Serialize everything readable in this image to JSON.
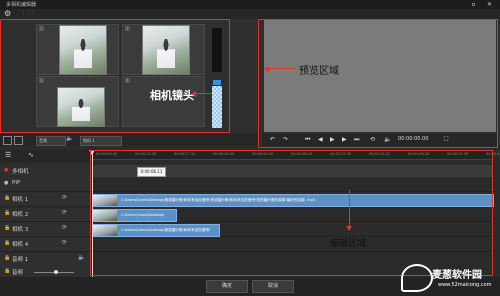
{
  "window": {
    "title": "多相机编辑器",
    "minimize": "▫",
    "close": "✕"
  },
  "toolbar": {
    "settings_icon": "gear-icon",
    "grip": "⋮⋮⋮"
  },
  "camera_grid": {
    "cells": [
      {
        "num": "1",
        "has_photo": true
      },
      {
        "num": "2",
        "has_photo": true
      },
      {
        "num": "3",
        "has_photo": true
      },
      {
        "num": "4",
        "has_photo": false
      }
    ]
  },
  "camera_toolbar": {
    "audio_label": "音频",
    "camera_label": "相机 1"
  },
  "preview_controls": {
    "timecode": "00:00:00.00"
  },
  "timeline": {
    "ruler_ticks": [
      "00:00:00.00",
      "00:00:13.20",
      "00:00:27.10",
      "00:00:40.30",
      "00:00:54.20",
      "00:01:08.10",
      "00:01:21.30",
      "00:01:35.20",
      "00:01:49.10",
      "00:02:02.30",
      "00:02:16.20"
    ],
    "tooltip": "0:00:06.11",
    "tracks": [
      {
        "label": "多相机"
      },
      {
        "label": "PIP"
      },
      {
        "label": "相机 1"
      },
      {
        "label": "相机 2"
      },
      {
        "label": "相机 3"
      },
      {
        "label": "相机 4"
      },
      {
        "label": "音频 1"
      },
      {
        "label": "音频"
      }
    ],
    "clips": [
      {
        "path": "C:\\Users\\Users\\Desktop\\美哭婚纱照!和你来谈恋爱吧!美哭婚纱照!和你来谈恋爱吧!您的婚纱照的故事!最好的结婚 .mp4"
      },
      {
        "path": "C:\\Users\\Users\\Desktop\\"
      },
      {
        "path": "C:\\Users\\Users\\Desktop\\美哭婚纱照!和你来谈恋爱吧!"
      }
    ]
  },
  "annotations": {
    "camera": "相机镜头",
    "preview": "预览区域",
    "edit": "编辑区域"
  },
  "footer": {
    "ok": "确定",
    "cancel": "取消"
  },
  "watermark": {
    "name": "麦葱软件园",
    "url": "www.52maicong.com"
  }
}
